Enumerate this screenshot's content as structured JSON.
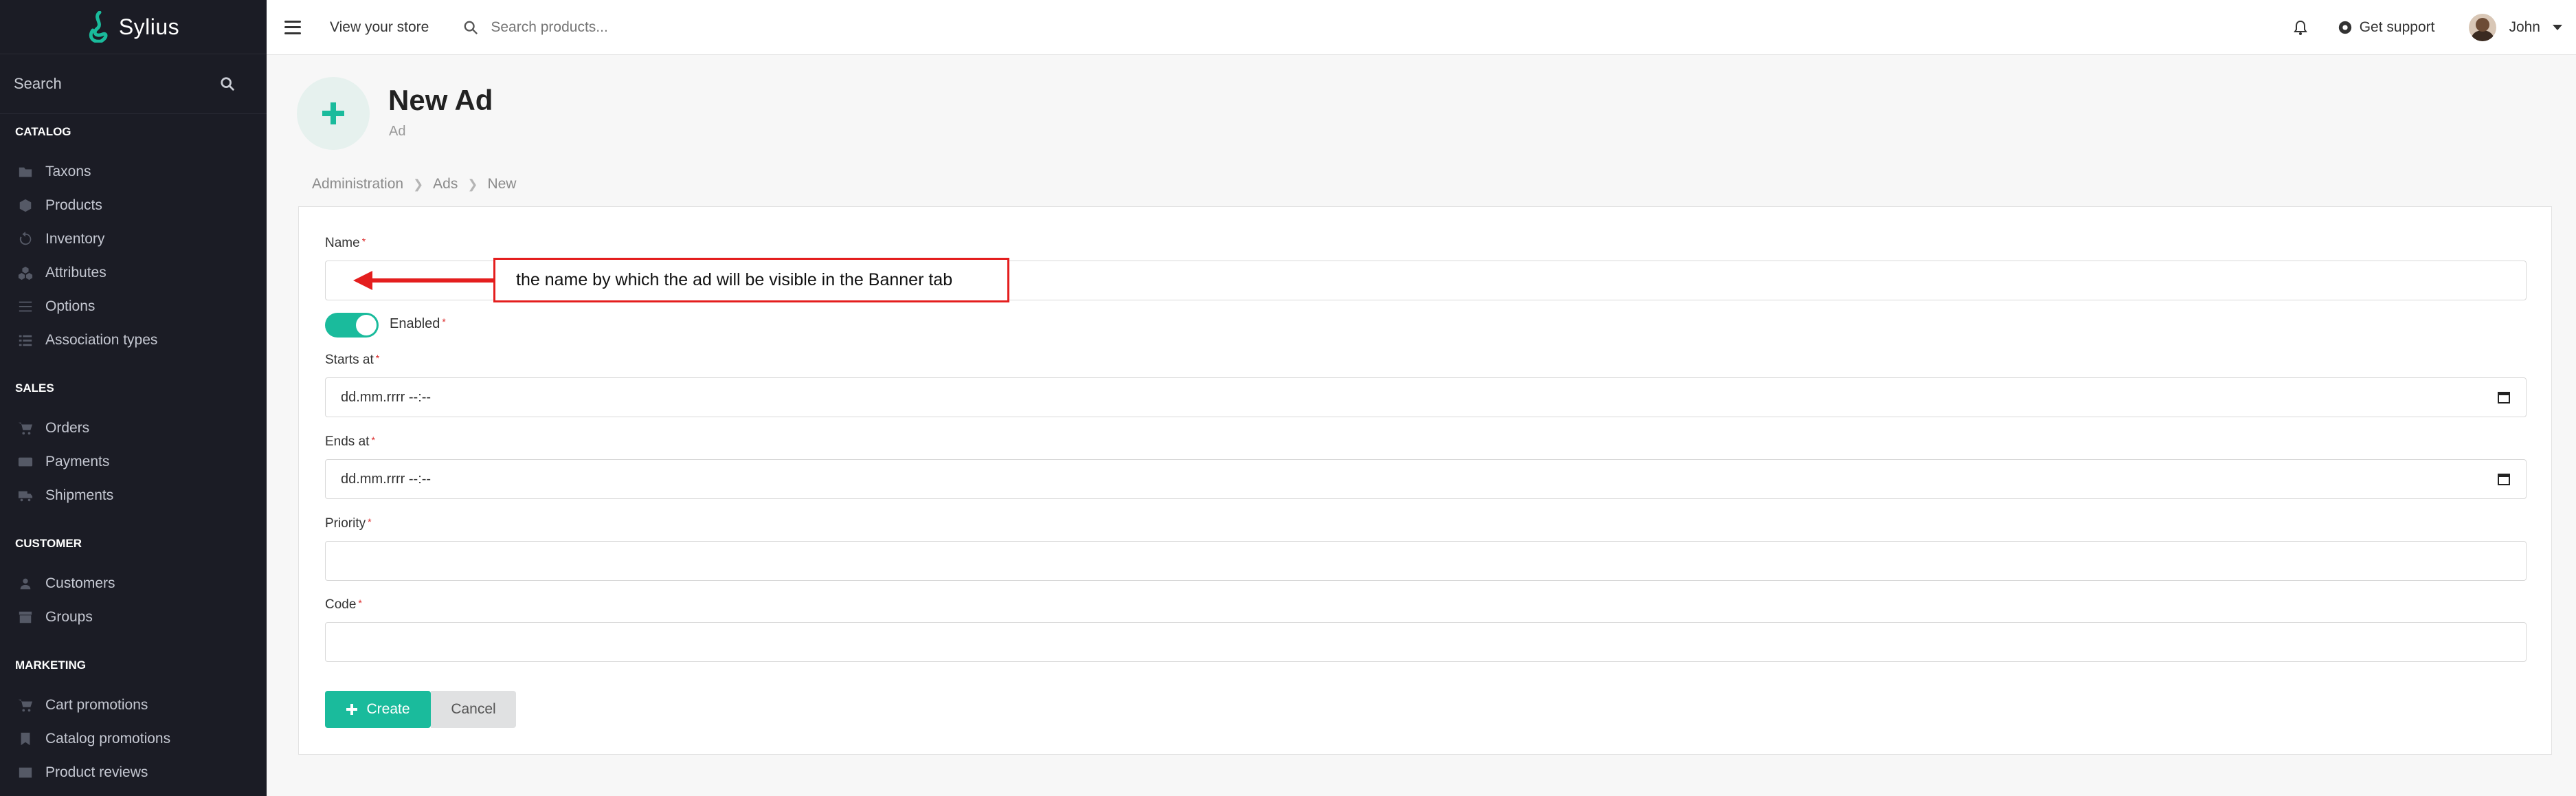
{
  "brand": {
    "name": "Sylius",
    "accent": "#1abb9c"
  },
  "sidebar": {
    "search_placeholder": "Search",
    "sections": [
      {
        "title": "CATALOG",
        "items": [
          {
            "label": "Taxons",
            "icon": "folder-icon"
          },
          {
            "label": "Products",
            "icon": "cube-icon"
          },
          {
            "label": "Inventory",
            "icon": "history-icon"
          },
          {
            "label": "Attributes",
            "icon": "cubes-icon"
          },
          {
            "label": "Options",
            "icon": "sliders-icon"
          },
          {
            "label": "Association types",
            "icon": "list-icon"
          }
        ]
      },
      {
        "title": "SALES",
        "items": [
          {
            "label": "Orders",
            "icon": "cart-icon"
          },
          {
            "label": "Payments",
            "icon": "payment-icon"
          },
          {
            "label": "Shipments",
            "icon": "truck-icon"
          }
        ]
      },
      {
        "title": "CUSTOMER",
        "items": [
          {
            "label": "Customers",
            "icon": "users-icon"
          },
          {
            "label": "Groups",
            "icon": "archive-icon"
          }
        ]
      },
      {
        "title": "MARKETING",
        "items": [
          {
            "label": "Cart promotions",
            "icon": "cart-icon"
          },
          {
            "label": "Catalog promotions",
            "icon": "bookmark-icon"
          },
          {
            "label": "Product reviews",
            "icon": "newspaper-icon"
          }
        ]
      }
    ]
  },
  "topbar": {
    "view_store": "View your store",
    "search_placeholder": "Search products...",
    "support": "Get support",
    "user": "John"
  },
  "header": {
    "title": "New Ad",
    "subtitle": "Ad"
  },
  "breadcrumb": [
    "Administration",
    "Ads",
    "New"
  ],
  "form": {
    "name_label": "Name",
    "name_value": "",
    "enabled_label": "Enabled",
    "enabled": true,
    "starts_label": "Starts at",
    "starts_value": "dd.mm.rrrr --:--",
    "ends_label": "Ends at",
    "ends_value": "dd.mm.rrrr --:--",
    "priority_label": "Priority",
    "priority_value": "",
    "code_label": "Code",
    "code_value": "",
    "required_marker": "*",
    "create_label": "Create",
    "cancel_label": "Cancel"
  },
  "annotation": {
    "text": "the name by which the ad will be visible in the Banner tab",
    "color": "#e41e1e"
  }
}
